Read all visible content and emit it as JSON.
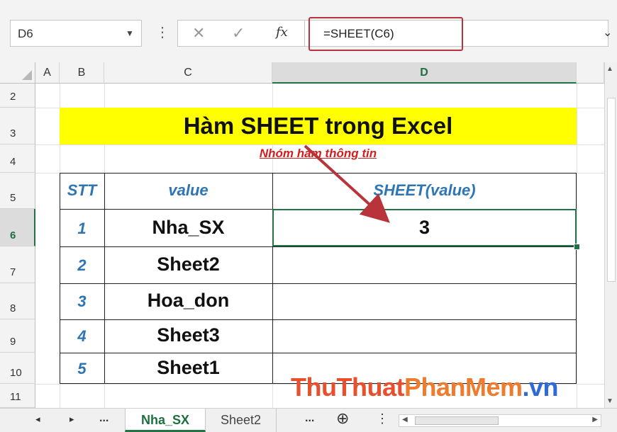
{
  "name_box": {
    "value": "D6"
  },
  "formula_bar": {
    "formula": "=SHEET(C6)",
    "fx_label": "fx"
  },
  "columns": [
    "A",
    "B",
    "C",
    "D"
  ],
  "rows": [
    "2",
    "3",
    "4",
    "5",
    "6",
    "7",
    "8",
    "9",
    "10",
    "11"
  ],
  "selected_column": "D",
  "selected_row": "6",
  "sheet": {
    "title": "Hàm SHEET trong Excel",
    "subtitle": "Nhóm hàm thông tin",
    "table": {
      "headers": [
        "STT",
        "value",
        "SHEET(value)"
      ],
      "rows": [
        {
          "stt": "1",
          "value": "Nha_SX",
          "result": "3"
        },
        {
          "stt": "2",
          "value": "Sheet2",
          "result": ""
        },
        {
          "stt": "3",
          "value": "Hoa_don",
          "result": ""
        },
        {
          "stt": "4",
          "value": "Sheet3",
          "result": ""
        },
        {
          "stt": "5",
          "value": "Sheet1",
          "result": ""
        }
      ]
    }
  },
  "watermark": {
    "part1": "ThuThuat",
    "part2": "PhanMem",
    "part3": ".vn"
  },
  "tabs": {
    "nav_prev": "◂",
    "nav_next": "▸",
    "more_left": "...",
    "items": [
      "Nha_SX",
      "Sheet2"
    ],
    "more_right": "...",
    "add": "⊕",
    "active": "Nha_SX"
  },
  "colors": {
    "accent": "#217346",
    "title_bg": "#ffff00",
    "header_text": "#2e75b6",
    "subtitle": "#d11f1f",
    "callout": "#b8333a"
  }
}
